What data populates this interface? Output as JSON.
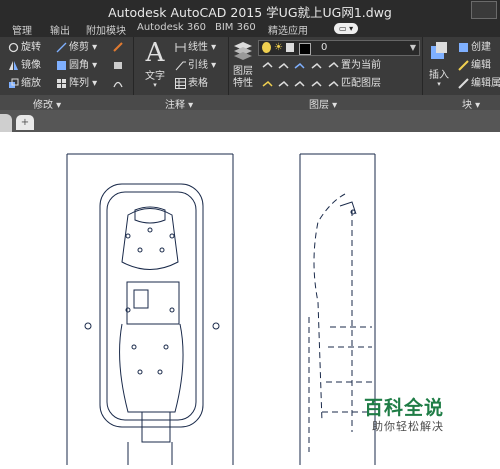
{
  "title": "Autodesk AutoCAD 2015    学UG就上UG网1.dwg",
  "menu_tabs": [
    "管理",
    "输出",
    "附加模块",
    "Autodesk 360",
    "BIM 360",
    "精选应用",
    "▭ ▾"
  ],
  "modify": {
    "rotate": "旋转",
    "trim": "修剪",
    "mirror": "镜像",
    "fillet": "圆角",
    "scale": "缩放",
    "array": "阵列",
    "panel_label": "修改 ▾"
  },
  "annotation": {
    "text": "文字",
    "linear": "线性",
    "leader": "引线",
    "table": "表格",
    "panel_label": "注释 ▾"
  },
  "layers": {
    "current_layer": "0",
    "properties": "图层\n特性",
    "set_current": "置为当前",
    "match_layer": "匹配图层",
    "panel_label": "图层 ▾"
  },
  "block": {
    "insert": "插入",
    "create": "创建",
    "edit": "编辑",
    "edit_attr": "编辑属",
    "panel_label": "块 ▾"
  },
  "doc_tab_new": "+",
  "watermark": {
    "title": "百科全说",
    "subtitle": "助你轻松解决"
  },
  "colors": {
    "ribbon_bg": "#3b3b3b",
    "titlebar_bg": "#2b2b2b",
    "drawing_line": "#1a2a4a",
    "watermark_green": "#1f7d46"
  }
}
